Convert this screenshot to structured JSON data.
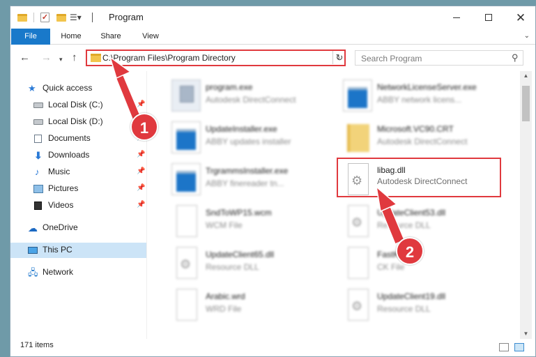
{
  "window": {
    "title": "Program",
    "controls": {
      "minimize": "minimize",
      "maximize": "maximize",
      "close": "✕"
    }
  },
  "ribbon": {
    "tabs": [
      "File",
      "Home",
      "Share",
      "View"
    ]
  },
  "navigation": {
    "address": "C:\\Program Files\\Program Directory",
    "search_placeholder": "Search Program"
  },
  "sidebar": {
    "items": [
      {
        "label": "Quick access",
        "icon": "star-icon"
      },
      {
        "label": "Local Disk (C:)",
        "icon": "drive-icon",
        "pinned": true
      },
      {
        "label": "Local Disk (D:)",
        "icon": "drive-icon"
      },
      {
        "label": "Documents",
        "icon": "documents-icon",
        "pinned": true
      },
      {
        "label": "Downloads",
        "icon": "download-icon",
        "pinned": true
      },
      {
        "label": "Music",
        "icon": "music-icon",
        "pinned": true
      },
      {
        "label": "Pictures",
        "icon": "pictures-icon",
        "pinned": true
      },
      {
        "label": "Videos",
        "icon": "videos-icon",
        "pinned": true
      },
      {
        "label": "OneDrive",
        "icon": "cloud-icon"
      },
      {
        "label": "This PC",
        "icon": "computer-icon",
        "selected": true
      },
      {
        "label": "Network",
        "icon": "network-icon"
      }
    ]
  },
  "files": [
    {
      "name": "program.exe",
      "type": "Autodesk DirectConnect",
      "icon": "setup-icon"
    },
    {
      "name": "NetworkLicenseServer.exe",
      "type": "ABBY network licens...",
      "icon": "application-icon"
    },
    {
      "name": "UpdateInstaller.exe",
      "type": "ABBY updates installer",
      "icon": "application-icon"
    },
    {
      "name": "Microsoft.VC90.CRT",
      "type": "Autodesk DirectConnect",
      "icon": "folder-icon"
    },
    {
      "name": "TrgrammsInstaller.exe",
      "type": "ABBY finereader tn...",
      "icon": "application-icon"
    },
    {
      "name": "libag.dll",
      "type": "Autodesk DirectConnect",
      "icon": "dll-gear-icon"
    },
    {
      "name": "SndToWP15.wcm",
      "type": "WCM File",
      "icon": "file-icon"
    },
    {
      "name": "UpdateClient53.dll",
      "type": "Resource DLL",
      "icon": "dll-gear-icon"
    },
    {
      "name": "UpdateClient65.dll",
      "type": "Resource DLL",
      "icon": "dll-gear-icon"
    },
    {
      "name": "FastK...",
      "type": "CK File",
      "icon": "file-icon"
    },
    {
      "name": "Arabic.wrd",
      "type": "WRD File",
      "icon": "file-icon"
    },
    {
      "name": "UpdateClient19.dll",
      "type": "Resource DLL",
      "icon": "dll-gear-icon"
    }
  ],
  "status": {
    "item_count": "171 items"
  },
  "annotations": {
    "badge_1": "1",
    "badge_2": "2",
    "highlight_color": "#e0393e"
  }
}
